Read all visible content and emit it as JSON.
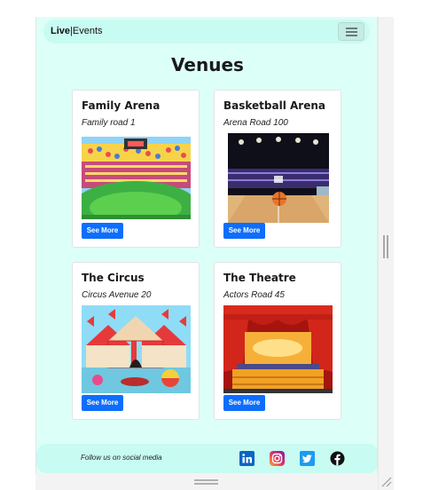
{
  "nav": {
    "brand_bold": "Live",
    "brand_sep": "|",
    "brand_rest": "Events"
  },
  "page": {
    "title": "Venues"
  },
  "venues": [
    {
      "name": "Family Arena",
      "address": "Family road 1",
      "button": "See More"
    },
    {
      "name": "Basketball Arena",
      "address": "Arena Road 100",
      "button": "See More"
    },
    {
      "name": "The Circus",
      "address": "Circus Avenue 20",
      "button": "See More"
    },
    {
      "name": "The Theatre",
      "address": "Actors Road 45",
      "button": "See More"
    }
  ],
  "footer": {
    "follow_text": "Follow us on social media",
    "social": [
      "linkedin-icon",
      "instagram-icon",
      "twitter-icon",
      "facebook-icon"
    ]
  },
  "colors": {
    "page_bg": "#dcfff8",
    "nav_bg": "#c8fbf1",
    "button": "#0d6efd"
  }
}
